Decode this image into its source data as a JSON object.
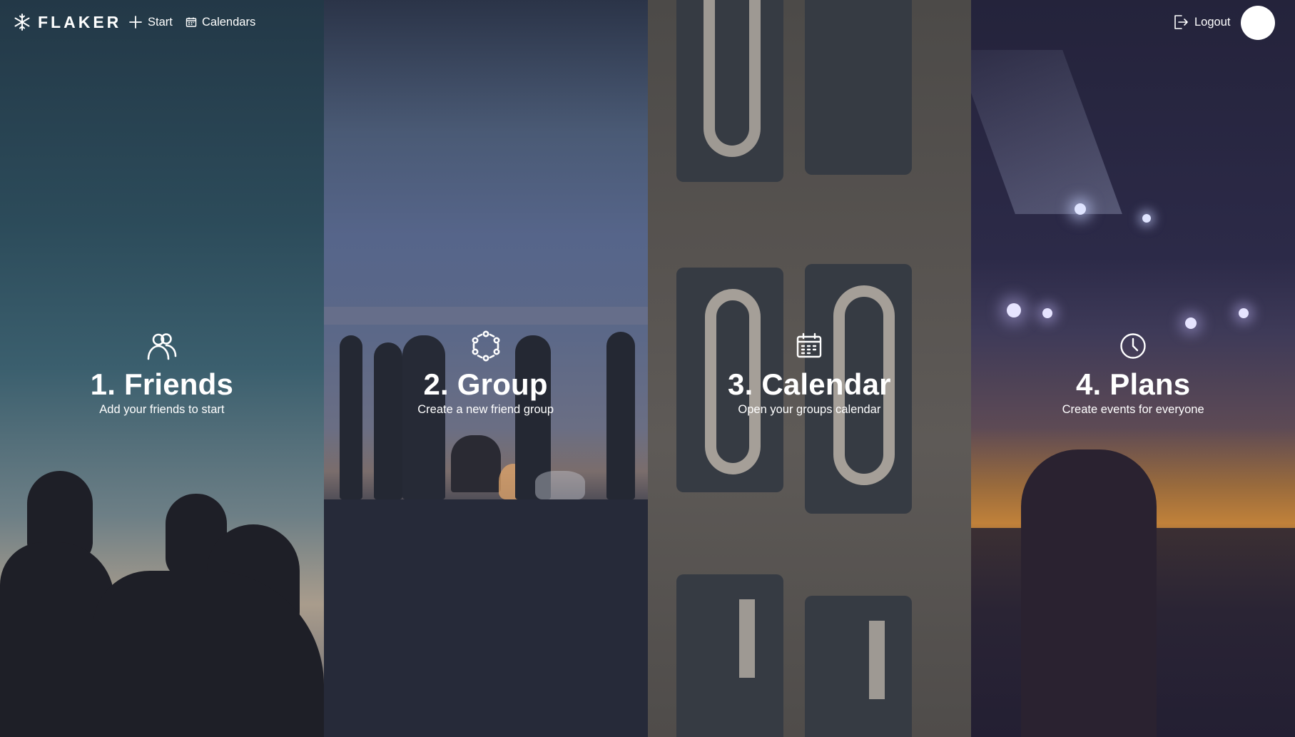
{
  "header": {
    "logo_text": "FLAKER",
    "nav": {
      "start": "Start",
      "calendars": "Calendars"
    },
    "logout": "Logout"
  },
  "steps": [
    {
      "title": "1. Friends",
      "subtitle": "Add your friends to start",
      "icon": "users-icon"
    },
    {
      "title": "2. Group",
      "subtitle": "Create a new friend group",
      "icon": "group-circle-icon"
    },
    {
      "title": "3. Calendar",
      "subtitle": "Open your groups calendar",
      "icon": "calendar-icon"
    },
    {
      "title": "4. Plans",
      "subtitle": "Create events for everyone",
      "icon": "clock-icon"
    }
  ],
  "colors": {
    "text": "#ffffff",
    "avatar": "#ffffff"
  }
}
